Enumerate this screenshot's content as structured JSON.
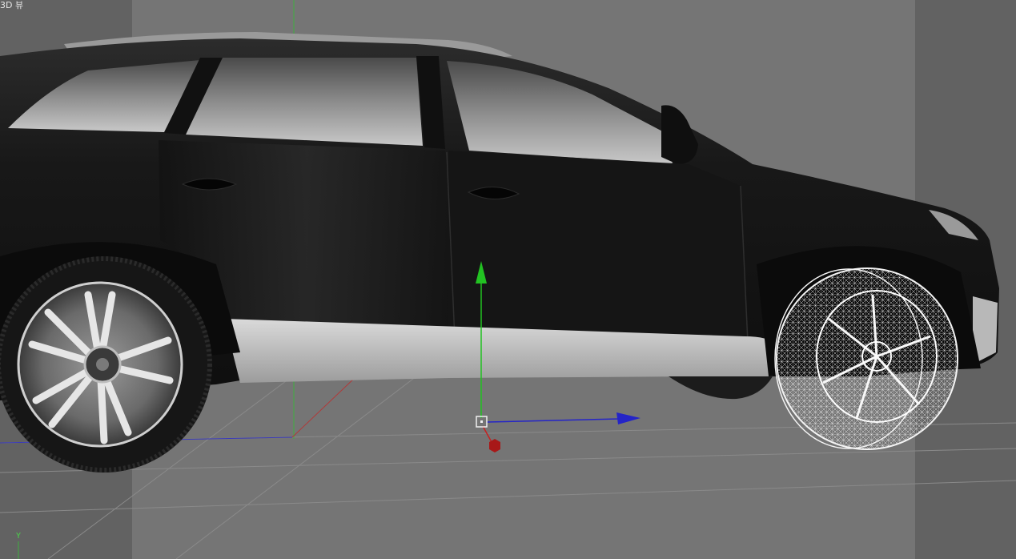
{
  "viewport": {
    "label": "3D 뷰",
    "axis_label_y": "Y"
  },
  "colors": {
    "background": "#757575",
    "safe_frame_shade": "#626262",
    "grid_line": "#8a8a8a",
    "car_body": "#151515",
    "lower_trim": "#c6c6c6",
    "gizmo_x": "#c82020",
    "gizmo_y": "#22c222",
    "gizmo_z": "#2424c8",
    "wireframe": "#f0f0f0"
  },
  "scene": {
    "object": "suv-car-model",
    "selected_part": "front-wheel",
    "selected_display": "wireframe",
    "gizmo_axes": [
      "x-axis",
      "y-axis",
      "z-axis"
    ]
  }
}
